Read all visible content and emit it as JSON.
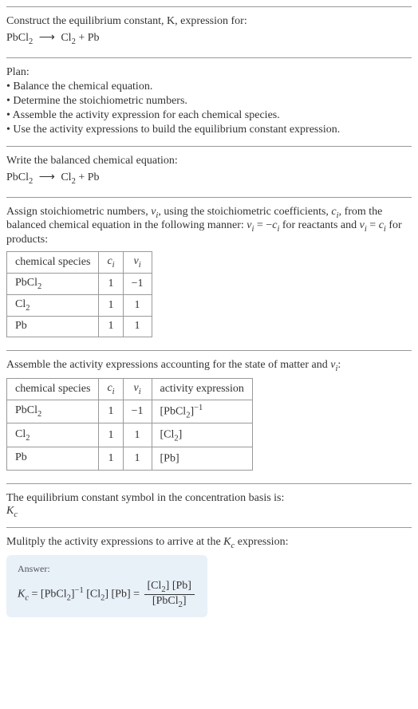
{
  "intro": {
    "line1": "Construct the equilibrium constant, K, expression for:",
    "eq_lhs": "PbCl",
    "eq_lhs_sub": "2",
    "arrow": "⟶",
    "eq_rhs1": "Cl",
    "eq_rhs1_sub": "2",
    "plus": " + ",
    "eq_rhs2": "Pb"
  },
  "plan": {
    "title": "Plan:",
    "items": [
      "• Balance the chemical equation.",
      "• Determine the stoichiometric numbers.",
      "• Assemble the activity expression for each chemical species.",
      "• Use the activity expressions to build the equilibrium constant expression."
    ]
  },
  "balanced": {
    "title": "Write the balanced chemical equation:",
    "eq_lhs": "PbCl",
    "eq_lhs_sub": "2",
    "arrow": "⟶",
    "eq_rhs1": "Cl",
    "eq_rhs1_sub": "2",
    "plus": " + ",
    "eq_rhs2": "Pb"
  },
  "stoich": {
    "intro_a": "Assign stoichiometric numbers, ",
    "nu_i": "ν",
    "nu_i_sub": "i",
    "intro_b": ", using the stoichiometric coefficients, ",
    "c_i": "c",
    "c_i_sub": "i",
    "intro_c": ", from the balanced chemical equation in the following manner: ",
    "rel1": "ν",
    "rel1_sub": "i",
    "rel1_eq": " = −",
    "rel1_c": "c",
    "rel1_c_sub": "i",
    "intro_d": " for reactants and ",
    "rel2": "ν",
    "rel2_sub": "i",
    "rel2_eq": " = ",
    "rel2_c": "c",
    "rel2_c_sub": "i",
    "intro_e": " for products:",
    "headers": [
      "chemical species",
      "c",
      "ν"
    ],
    "header_subs": [
      "",
      "i",
      "i"
    ],
    "rows": [
      {
        "species": "PbCl",
        "species_sub": "2",
        "c": "1",
        "nu": "−1"
      },
      {
        "species": "Cl",
        "species_sub": "2",
        "c": "1",
        "nu": "1"
      },
      {
        "species": "Pb",
        "species_sub": "",
        "c": "1",
        "nu": "1"
      }
    ]
  },
  "activity": {
    "intro_a": "Assemble the activity expressions accounting for the state of matter and ",
    "nu": "ν",
    "nu_sub": "i",
    "intro_b": ":",
    "headers": [
      "chemical species",
      "c",
      "ν",
      "activity expression"
    ],
    "header_subs": [
      "",
      "i",
      "i",
      ""
    ],
    "rows": [
      {
        "species": "PbCl",
        "species_sub": "2",
        "c": "1",
        "nu": "−1",
        "act": "[PbCl",
        "act_sub": "2",
        "act_close": "]",
        "act_sup": "−1"
      },
      {
        "species": "Cl",
        "species_sub": "2",
        "c": "1",
        "nu": "1",
        "act": "[Cl",
        "act_sub": "2",
        "act_close": "]",
        "act_sup": ""
      },
      {
        "species": "Pb",
        "species_sub": "",
        "c": "1",
        "nu": "1",
        "act": "[Pb]",
        "act_sub": "",
        "act_close": "",
        "act_sup": ""
      }
    ]
  },
  "symbol": {
    "line": "The equilibrium constant symbol in the concentration basis is:",
    "K": "K",
    "K_sub": "c"
  },
  "multiply": {
    "intro_a": "Mulitply the activity expressions to arrive at the ",
    "K": "K",
    "K_sub": "c",
    "intro_b": " expression:"
  },
  "answer": {
    "label": "Answer:",
    "K": "K",
    "K_sub": "c",
    "eq": " = ",
    "t1": "[PbCl",
    "t1_sub": "2",
    "t1_close": "]",
    "t1_sup": "−1",
    "t2": " [Cl",
    "t2_sub": "2",
    "t2_close": "] [Pb] = ",
    "num1": "[Cl",
    "num1_sub": "2",
    "num1_close": "] [Pb]",
    "den1": "[PbCl",
    "den1_sub": "2",
    "den1_close": "]"
  }
}
